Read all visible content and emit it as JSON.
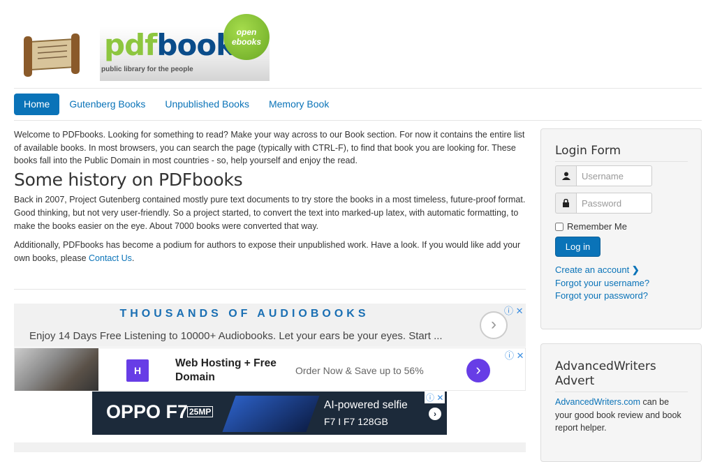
{
  "logo": {
    "word_pdf": "pdf",
    "word_books": "books",
    "tagline": "public library for the people",
    "seal_line1": "open",
    "seal_line2": "ebooks"
  },
  "nav": {
    "items": [
      {
        "label": "Home",
        "active": true
      },
      {
        "label": "Gutenberg Books",
        "active": false
      },
      {
        "label": "Unpublished Books",
        "active": false
      },
      {
        "label": "Memory Book",
        "active": false
      }
    ]
  },
  "main": {
    "intro": "Welcome to PDFbooks. Looking for something to read? Make your way across to our Book section. For now it contains the entire list of available books. In most browsers, you can search the page (typically with CTRL-F), to find that book you are looking for. These books fall into the Public Domain in most countries - so, help yourself and enjoy the read.",
    "heading": "Some history on PDFbooks",
    "history": "Back in 2007, Project Gutenberg contained mostly pure text documents to try store the books in a most timeless, future-proof format. Good thinking, but not very user-friendly. So a project started, to convert the text into marked-up latex, with automatic formatting, to make the books easier on the eye. About 7000 books were converted that way.",
    "additional": "Additionally, PDFbooks has become a podium for authors to expose their unpublished work. Have a look. If you would like add your own books, please",
    "contact_link": "Contact Us",
    "additional_end": "."
  },
  "ads": {
    "audiobooks_heading": "THOUSANDS OF AUDIOBOOKS",
    "audiobooks_body": "Enjoy 14 Days Free Listening to 10000+ Audiobooks. Let your ears be your eyes. Start ...",
    "hosting_title": "Web Hosting + Free Domain",
    "hosting_sub": "Order Now & Save up to 56%",
    "hosting_logo": "H",
    "oppo_brand": "OPPO F7",
    "oppo_mp": "25MP",
    "oppo_line1": "AI-powered selfie",
    "oppo_line2": "F7 I F7 128GB"
  },
  "login": {
    "title": "Login Form",
    "username_placeholder": "Username",
    "password_placeholder": "Password",
    "remember": "Remember Me",
    "button": "Log in",
    "create": "Create an account",
    "forgot_user": "Forgot your username?",
    "forgot_pass": "Forgot your password?"
  },
  "advert": {
    "title_line1": "AdvancedWriters",
    "title_line2": "Advert",
    "link": "AdvancedWriters.com",
    "text": " can be your good book review and book report helper."
  }
}
